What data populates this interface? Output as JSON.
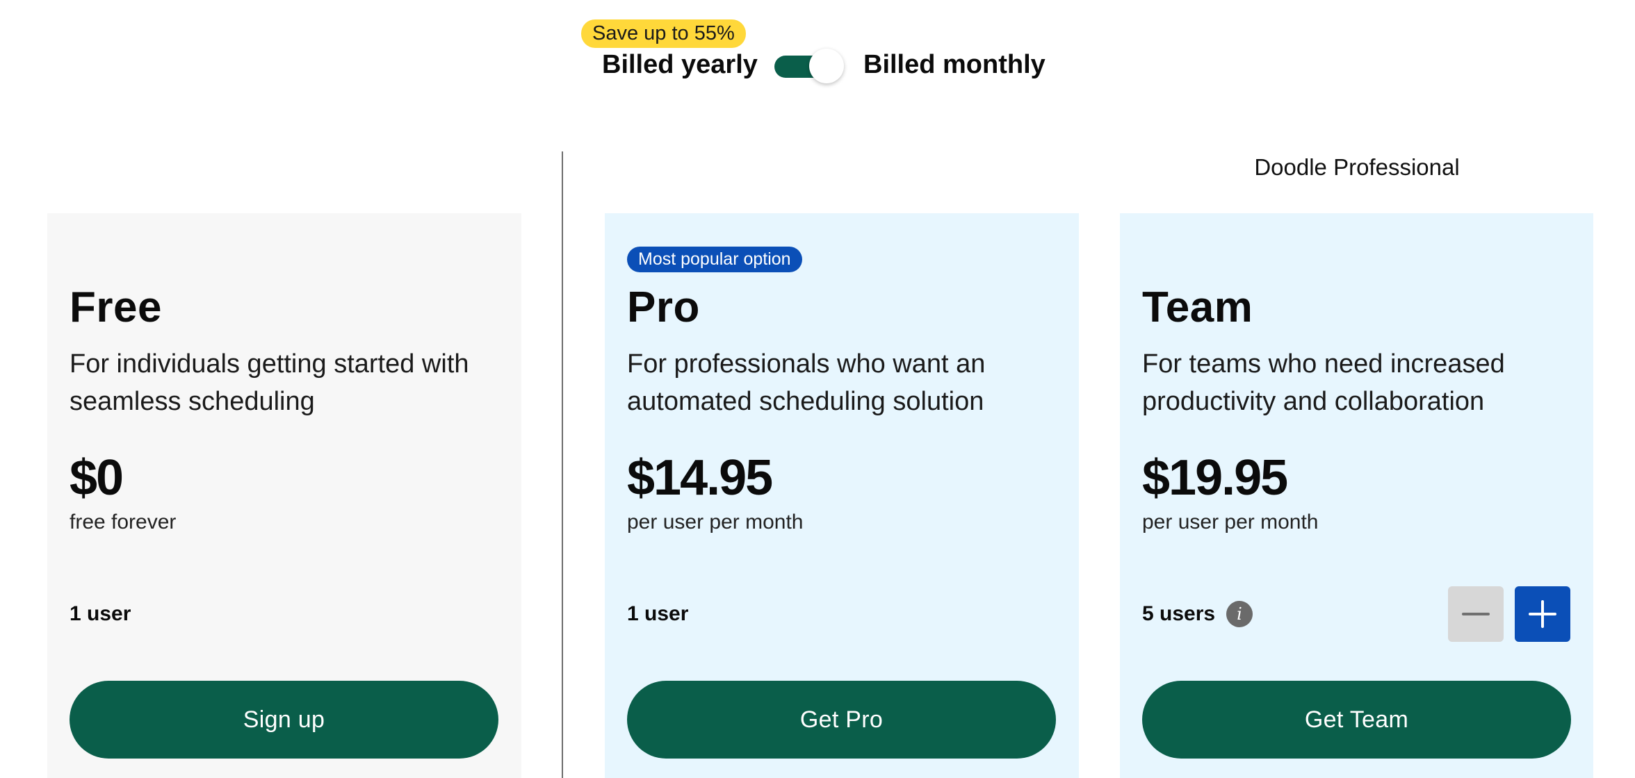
{
  "billing": {
    "save_badge": "Save up to 55%",
    "yearly_label": "Billed yearly",
    "monthly_label": "Billed monthly",
    "toggle_state": "on"
  },
  "group_title": "Doodle Professional",
  "plans": [
    {
      "name": "Free",
      "description": "For individuals getting started with seamless scheduling",
      "price": "$0",
      "price_note": "free forever",
      "users": "1 user",
      "cta": "Sign up"
    },
    {
      "badge": "Most popular option",
      "name": "Pro",
      "description": "For professionals who want an automated scheduling solution",
      "price": "$14.95",
      "price_note": "per user per month",
      "users": "1 user",
      "cta": "Get Pro"
    },
    {
      "name": "Team",
      "description": "For teams who need increased productivity and collaboration",
      "price": "$19.95",
      "price_note": "per user per month",
      "users": "5 users",
      "cta": "Get Team"
    }
  ],
  "colors": {
    "brand_green": "#0a5e4a",
    "accent_blue": "#0b4fb7",
    "badge_yellow": "#ffd83a",
    "card_blue_bg": "#e7f6fe",
    "card_gray_bg": "#f7f7f7"
  },
  "icons": {
    "info": "info-icon",
    "minus": "minus-icon",
    "plus": "plus-icon"
  }
}
